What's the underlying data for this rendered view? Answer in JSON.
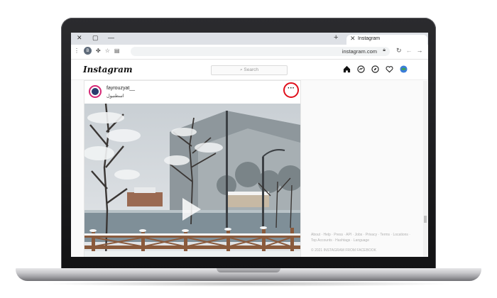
{
  "browser": {
    "tab_title": "Instagram",
    "url": "instagram.com",
    "new_tab_symbol": "+",
    "tab_close_symbol": "✕",
    "window_close_symbol": "✕",
    "window_restore_symbol": "▢",
    "window_minimize_symbol": "—",
    "profile_initial": "B"
  },
  "instagram": {
    "logo": "Instagram",
    "search_placeholder": "Search",
    "nav_icons": [
      "home-icon",
      "messenger-icon",
      "explore-icon",
      "heart-icon",
      "profile-icon"
    ]
  },
  "post": {
    "username": "fayrouzyat__",
    "location": "اسطنبول",
    "more_symbol": "···",
    "media": "video-snowy-lake-trees"
  },
  "footer": {
    "links_line1": "About · Help · Press · API · Jobs · Privacy · Terms · Locations ·",
    "links_line2": "Top Accounts · Hashtags · Language",
    "copyright": "© 2021 INSTAGRAM FROM FACEBOOK"
  },
  "colors": {
    "highlight_circle": "#e0101c",
    "instagram_gradient": [
      "#f9a31b",
      "#e2336e",
      "#8a3ab9"
    ]
  }
}
